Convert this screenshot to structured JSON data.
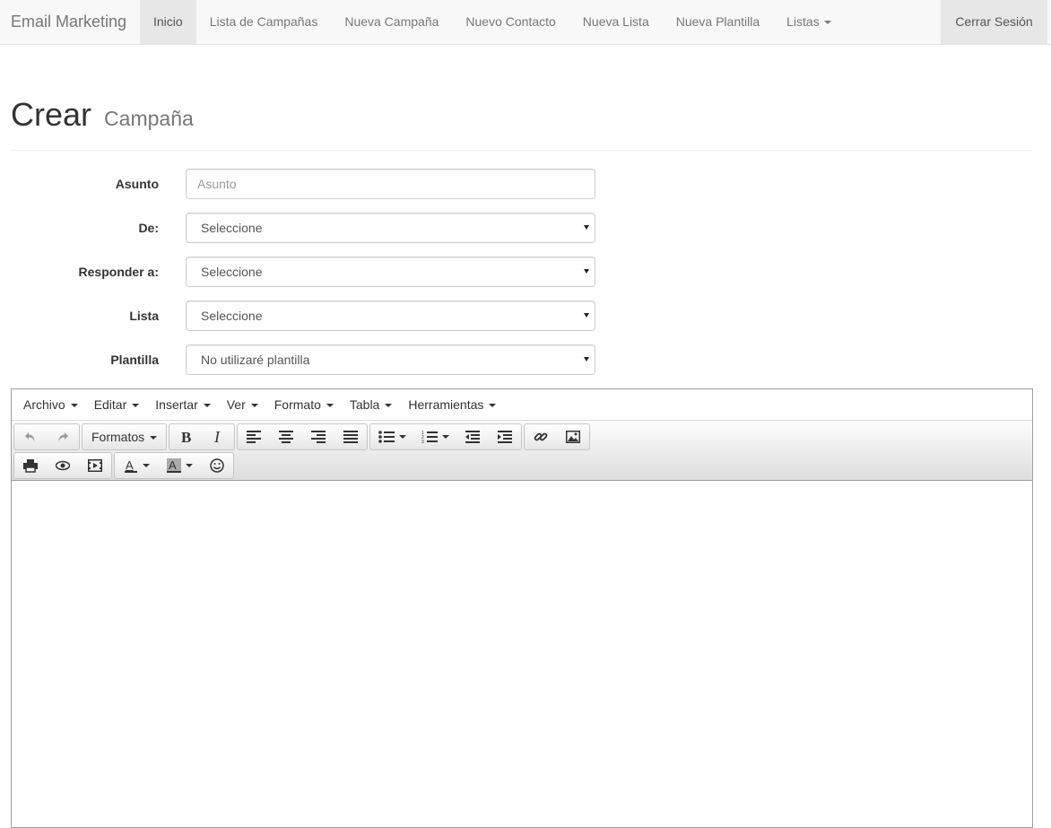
{
  "navbar": {
    "brand": "Email Marketing",
    "items": [
      {
        "label": "Inicio"
      },
      {
        "label": "Lista de Campañas"
      },
      {
        "label": "Nueva Campaña"
      },
      {
        "label": "Nuevo Contacto"
      },
      {
        "label": "Nueva Lista"
      },
      {
        "label": "Nueva Plantilla"
      },
      {
        "label": "Listas"
      }
    ],
    "active_item": "Inicio",
    "logout": "Cerrar Sesión"
  },
  "header": {
    "title": "Crear",
    "subtitle": "Campaña"
  },
  "form": {
    "asunto": {
      "label": "Asunto",
      "value": "",
      "placeholder": "Asunto"
    },
    "de": {
      "label": "De:",
      "selected": "Seleccione"
    },
    "responder": {
      "label": "Responder a:",
      "selected": "Seleccione"
    },
    "lista": {
      "label": "Lista",
      "selected": "Seleccione"
    },
    "plantilla": {
      "label": "Plantilla",
      "selected": "No utilizaré plantilla"
    }
  },
  "editor": {
    "menu": [
      {
        "label": "Archivo"
      },
      {
        "label": "Editar"
      },
      {
        "label": "Insertar"
      },
      {
        "label": "Ver"
      },
      {
        "label": "Formato"
      },
      {
        "label": "Tabla"
      },
      {
        "label": "Herramientas"
      }
    ],
    "formats_label": "Formatos",
    "toolbar_icons": [
      "undo-icon",
      "redo-icon",
      "bold-icon",
      "italic-icon",
      "align-left-icon",
      "align-center-icon",
      "align-right-icon",
      "align-justify-icon",
      "bullet-list-icon",
      "numbered-list-icon",
      "outdent-icon",
      "indent-icon",
      "link-icon",
      "image-icon",
      "print-icon",
      "preview-icon",
      "media-icon",
      "text-color-icon",
      "background-color-icon",
      "emoticon-icon"
    ],
    "content": ""
  },
  "colors": {
    "navbar_bg": "#f8f8f8",
    "nav_active_bg": "#e7e7e7",
    "nav_text": "#777777",
    "label_text": "#333333"
  }
}
